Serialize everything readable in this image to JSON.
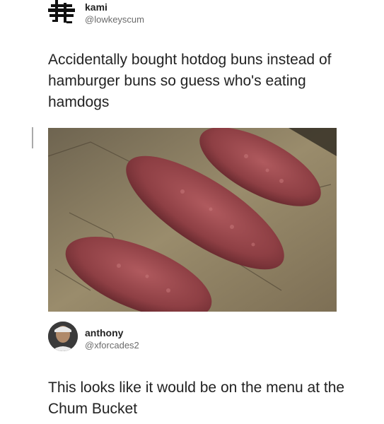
{
  "tweet1": {
    "name": "kami",
    "handle": "@lowkeyscum",
    "text": "Accidentally bought hotdog buns instead of hamburger buns so guess who's eating hamdogs"
  },
  "tweet2": {
    "name": "anthony",
    "handle": "@xforcades2",
    "text": "This looks like it would be on the menu at the Chum Bucket"
  }
}
